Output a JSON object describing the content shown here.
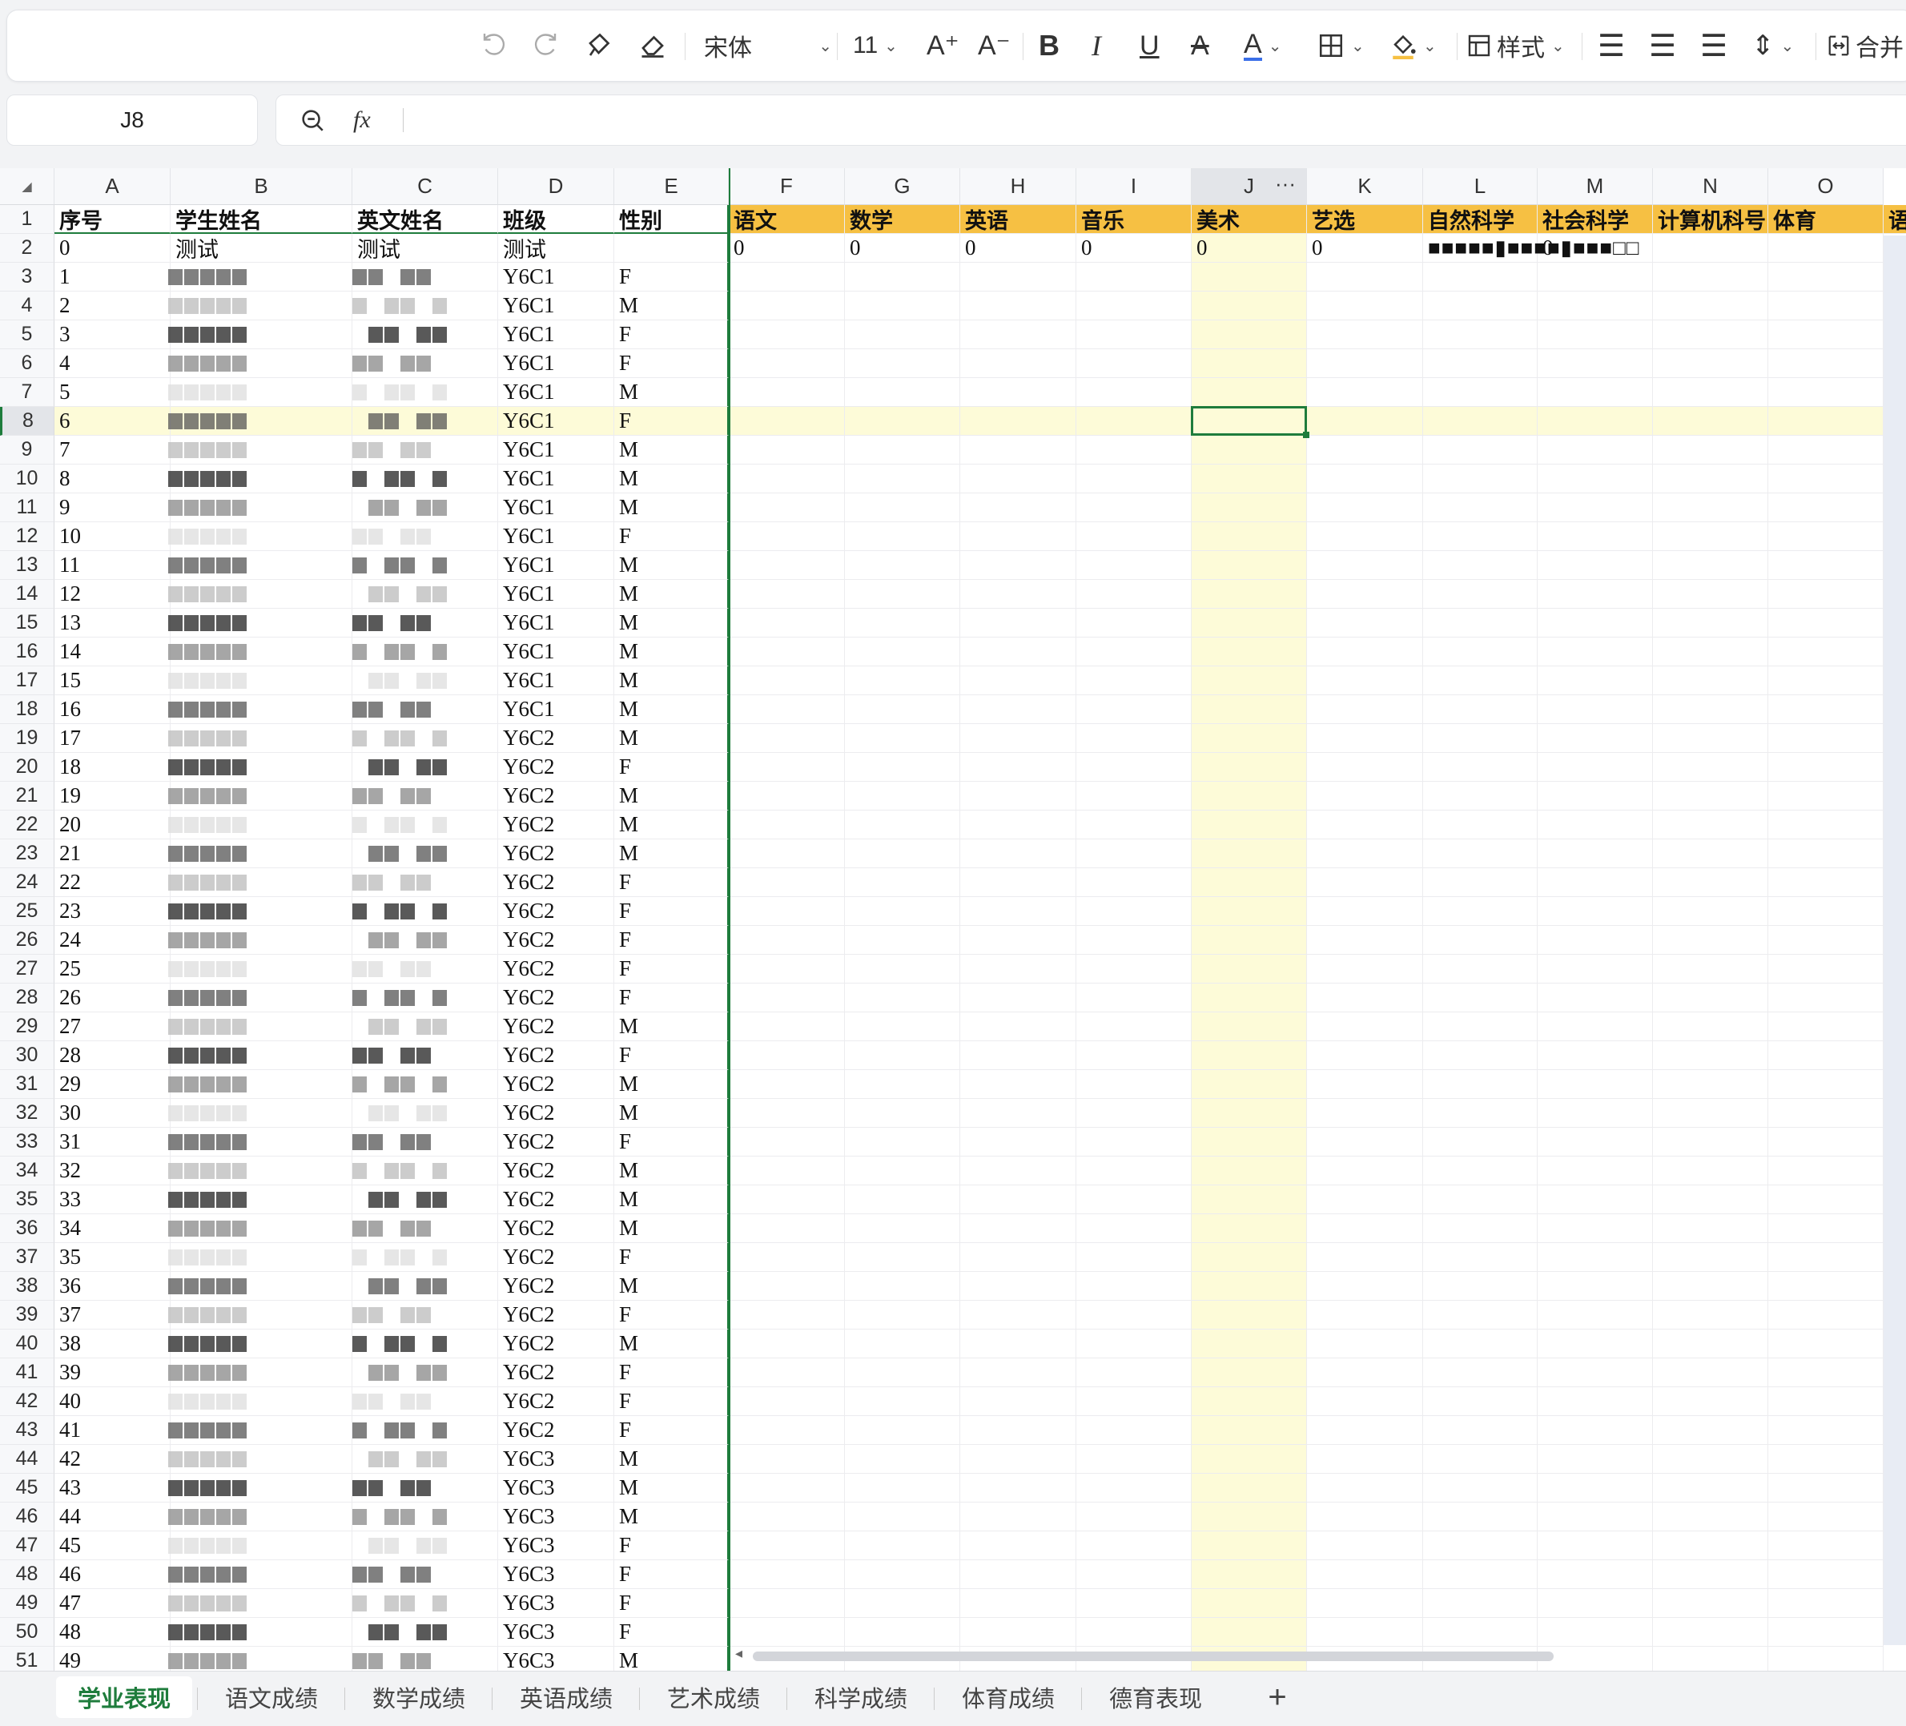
{
  "toolbar": {
    "font_name": "宋体",
    "font_size": "11",
    "style_label": "样式",
    "merge_label": "合并"
  },
  "formula": {
    "cell_ref": "J8",
    "fx_label": "fx",
    "value": ""
  },
  "columns": [
    "A",
    "B",
    "C",
    "D",
    "E",
    "F",
    "G",
    "H",
    "I",
    "J",
    "K",
    "L",
    "M",
    "N",
    "O"
  ],
  "header_row": [
    "序号",
    "学生姓名",
    "英文姓名",
    "班级",
    "性别",
    "语文",
    "数学",
    "英语",
    "音乐",
    "美术",
    "艺选",
    "自然科学",
    "社会科学",
    "计算机科号",
    "体育",
    "语"
  ],
  "test_row": [
    "0",
    "测试",
    "测试",
    "测试",
    "",
    "0",
    "0",
    "0",
    "0",
    "0",
    "0",
    "■■■■■▮■■■■▮■■■□□",
    "0"
  ],
  "students": [
    {
      "no": "1",
      "class": "Y6C1",
      "sex": "F"
    },
    {
      "no": "2",
      "class": "Y6C1",
      "sex": "M"
    },
    {
      "no": "3",
      "class": "Y6C1",
      "sex": "F"
    },
    {
      "no": "4",
      "class": "Y6C1",
      "sex": "F"
    },
    {
      "no": "5",
      "class": "Y6C1",
      "sex": "M"
    },
    {
      "no": "6",
      "class": "Y6C1",
      "sex": "F"
    },
    {
      "no": "7",
      "class": "Y6C1",
      "sex": "M"
    },
    {
      "no": "8",
      "class": "Y6C1",
      "sex": "M"
    },
    {
      "no": "9",
      "class": "Y6C1",
      "sex": "M"
    },
    {
      "no": "10",
      "class": "Y6C1",
      "sex": "F"
    },
    {
      "no": "11",
      "class": "Y6C1",
      "sex": "M"
    },
    {
      "no": "12",
      "class": "Y6C1",
      "sex": "M"
    },
    {
      "no": "13",
      "class": "Y6C1",
      "sex": "M"
    },
    {
      "no": "14",
      "class": "Y6C1",
      "sex": "M"
    },
    {
      "no": "15",
      "class": "Y6C1",
      "sex": "M"
    },
    {
      "no": "16",
      "class": "Y6C1",
      "sex": "M"
    },
    {
      "no": "17",
      "class": "Y6C2",
      "sex": "M"
    },
    {
      "no": "18",
      "class": "Y6C2",
      "sex": "F"
    },
    {
      "no": "19",
      "class": "Y6C2",
      "sex": "M"
    },
    {
      "no": "20",
      "class": "Y6C2",
      "sex": "M"
    },
    {
      "no": "21",
      "class": "Y6C2",
      "sex": "M"
    },
    {
      "no": "22",
      "class": "Y6C2",
      "sex": "F"
    },
    {
      "no": "23",
      "class": "Y6C2",
      "sex": "F"
    },
    {
      "no": "24",
      "class": "Y6C2",
      "sex": "F"
    },
    {
      "no": "25",
      "class": "Y6C2",
      "sex": "F"
    },
    {
      "no": "26",
      "class": "Y6C2",
      "sex": "F"
    },
    {
      "no": "27",
      "class": "Y6C2",
      "sex": "M"
    },
    {
      "no": "28",
      "class": "Y6C2",
      "sex": "F"
    },
    {
      "no": "29",
      "class": "Y6C2",
      "sex": "M"
    },
    {
      "no": "30",
      "class": "Y6C2",
      "sex": "M"
    },
    {
      "no": "31",
      "class": "Y6C2",
      "sex": "F"
    },
    {
      "no": "32",
      "class": "Y6C2",
      "sex": "M"
    },
    {
      "no": "33",
      "class": "Y6C2",
      "sex": "M"
    },
    {
      "no": "34",
      "class": "Y6C2",
      "sex": "M"
    },
    {
      "no": "35",
      "class": "Y6C2",
      "sex": "F"
    },
    {
      "no": "36",
      "class": "Y6C2",
      "sex": "M"
    },
    {
      "no": "37",
      "class": "Y6C2",
      "sex": "F"
    },
    {
      "no": "38",
      "class": "Y6C2",
      "sex": "M"
    },
    {
      "no": "39",
      "class": "Y6C2",
      "sex": "F"
    },
    {
      "no": "40",
      "class": "Y6C2",
      "sex": "F"
    },
    {
      "no": "41",
      "class": "Y6C2",
      "sex": "F"
    },
    {
      "no": "42",
      "class": "Y6C3",
      "sex": "M"
    },
    {
      "no": "43",
      "class": "Y6C3",
      "sex": "M"
    },
    {
      "no": "44",
      "class": "Y6C3",
      "sex": "M"
    },
    {
      "no": "45",
      "class": "Y6C3",
      "sex": "F"
    },
    {
      "no": "46",
      "class": "Y6C3",
      "sex": "F"
    },
    {
      "no": "47",
      "class": "Y6C3",
      "sex": "F"
    },
    {
      "no": "48",
      "class": "Y6C3",
      "sex": "F"
    },
    {
      "no": "49",
      "class": "Y6C3",
      "sex": "M"
    }
  ],
  "selected": {
    "row": 8,
    "col": "J"
  },
  "colors": {
    "accent": "#1e7c3c",
    "header_fill": "#f6c043",
    "highlight": "#fdfbd8",
    "selection": "#1e7c3c"
  },
  "sheet_tabs": [
    "学业表现",
    "语文成绩",
    "数学成绩",
    "英语成绩",
    "艺术成绩",
    "科学成绩",
    "体育成绩",
    "德育表现"
  ],
  "active_tab": "学业表现",
  "add_tab_label": "+"
}
